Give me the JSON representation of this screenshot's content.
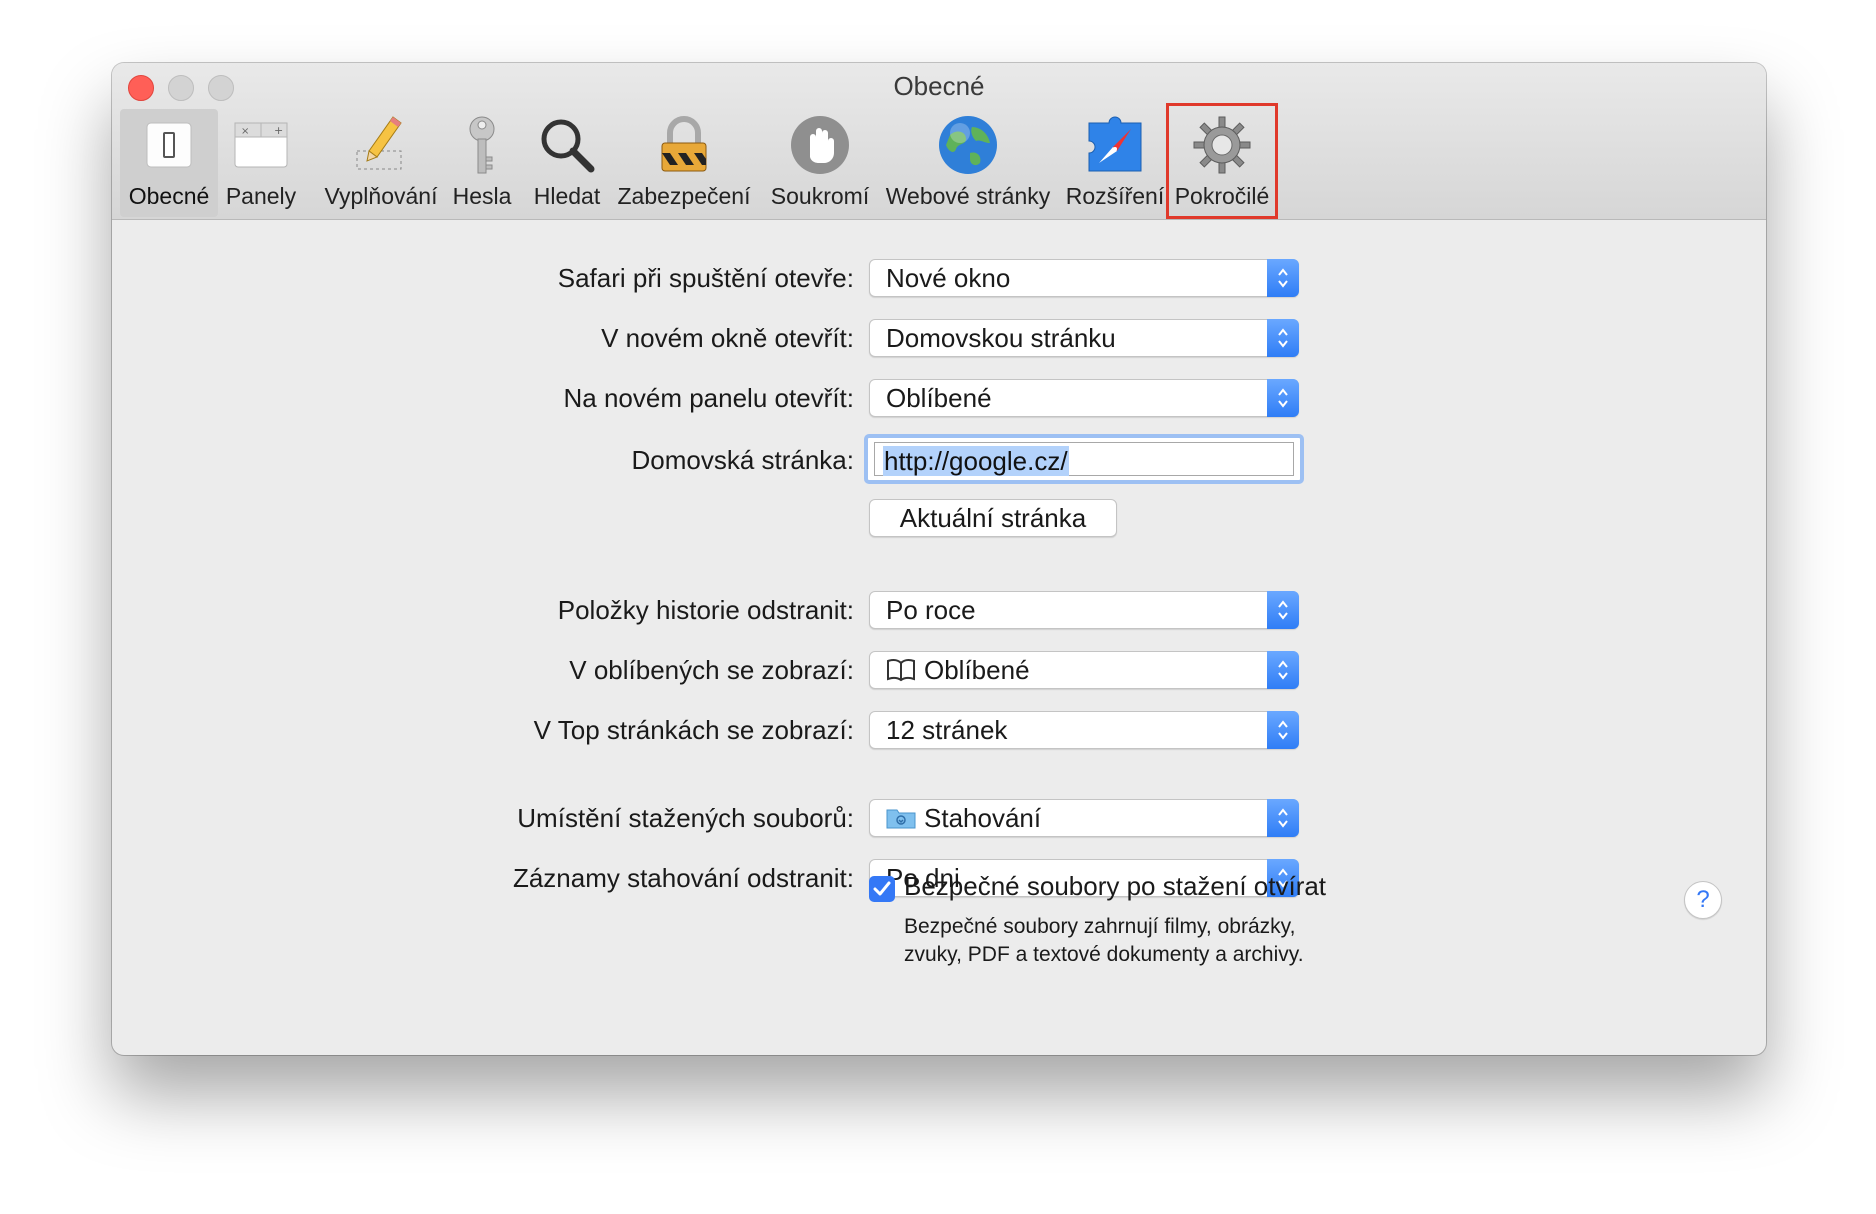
{
  "window": {
    "title": "Obecné"
  },
  "toolbar": {
    "tabs": [
      {
        "label": "Obecné",
        "icon": "general-switch-icon"
      },
      {
        "label": "Panely",
        "icon": "tabs-icon"
      },
      {
        "label": "Vyplňování",
        "icon": "pencil-autofill-icon"
      },
      {
        "label": "Hesla",
        "icon": "key-icon"
      },
      {
        "label": "Hledat",
        "icon": "magnifier-icon"
      },
      {
        "label": "Zabezpečení",
        "icon": "padlock-icon"
      },
      {
        "label": "Soukromí",
        "icon": "hand-icon"
      },
      {
        "label": "Webové stránky",
        "icon": "globe-icon"
      },
      {
        "label": "Rozšíření",
        "icon": "puzzle-compass-icon"
      },
      {
        "label": "Pokročilé",
        "icon": "gear-icon"
      }
    ],
    "active_tab": "Obecné",
    "highlighted_tab": "Pokročilé",
    "highlight_color": "#e0392b"
  },
  "settings": {
    "startup_label": "Safari při spuštění otevře:",
    "startup_value": "Nové okno",
    "new_window_label": "V novém okně otevřít:",
    "new_window_value": "Domovskou stránku",
    "new_tab_label": "Na novém panelu otevřít:",
    "new_tab_value": "Oblíbené",
    "homepage_label": "Domovská stránka:",
    "homepage_value": "http://google.cz/",
    "current_page_button": "Aktuální stránka",
    "history_label": "Položky historie odstranit:",
    "history_value": "Po roce",
    "favorites_label": "V oblíbených se zobrazí:",
    "favorites_value": "Oblíbené",
    "topsites_label": "V Top stránkách se zobrazí:",
    "topsites_value": "12 stránek",
    "download_location_label": "Umístění stažených souborů:",
    "download_location_value": "Stahování",
    "download_clear_label": "Záznamy stahování odstranit:",
    "download_clear_value": "Po dni",
    "safe_files_checked": true,
    "safe_files_label": "Bezpečné soubory po stažení otvírat",
    "safe_files_desc_line1": "Bezpečné soubory zahrnují filmy, obrázky,",
    "safe_files_desc_line2": "zvuky, PDF a textové dokumenty a archivy.",
    "help": "?"
  },
  "colors": {
    "accent": "#3478f6",
    "close_button": "#ff5f57"
  }
}
